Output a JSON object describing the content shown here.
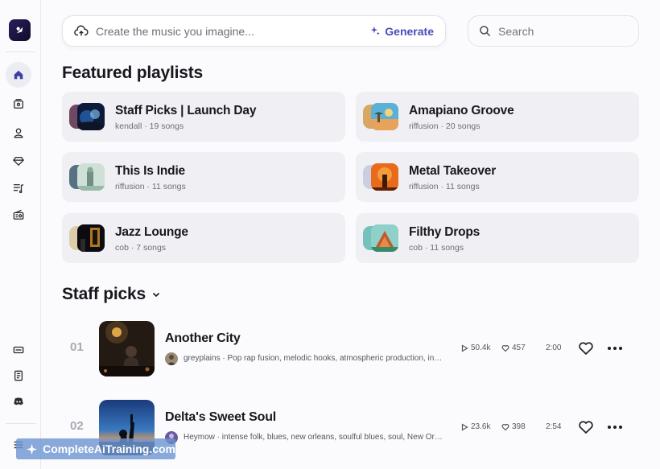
{
  "app": {
    "logo_icon": "riffusion-logo-icon",
    "accent_color": "#4b4bb8"
  },
  "sidebar": {
    "top_items": [
      {
        "icon": "home-icon",
        "active": true
      },
      {
        "icon": "library-icon",
        "active": false
      },
      {
        "icon": "profile-icon",
        "active": false
      },
      {
        "icon": "gem-icon",
        "active": false
      },
      {
        "icon": "playlist-icon",
        "active": false
      },
      {
        "icon": "radio-icon",
        "active": false
      }
    ],
    "bottom_items": [
      {
        "icon": "ticket-icon"
      },
      {
        "icon": "document-icon"
      },
      {
        "icon": "discord-icon"
      },
      {
        "icon": "menu-icon"
      }
    ]
  },
  "prompt_bar": {
    "placeholder": "Create the music you imagine...",
    "generate_label": "Generate"
  },
  "search": {
    "placeholder": "Search"
  },
  "featured": {
    "title": "Featured playlists",
    "playlists": [
      {
        "title": "Staff Picks | Launch Day",
        "meta": "kendall · 19 songs"
      },
      {
        "title": "Amapiano Groove",
        "meta": "riffusion · 20 songs"
      },
      {
        "title": "This Is Indie",
        "meta": "riffusion · 11 songs"
      },
      {
        "title": "Metal Takeover",
        "meta": "riffusion · 11 songs"
      },
      {
        "title": "Jazz Lounge",
        "meta": "cob · 7 songs"
      },
      {
        "title": "Filthy Drops",
        "meta": "cob · 11 songs"
      }
    ]
  },
  "staff_picks": {
    "title": "Staff picks",
    "tracks": [
      {
        "number": "01",
        "title": "Another City",
        "meta": "greyplains · Pop rap fusion, melodic hooks, atmospheric production, introspective lyrics",
        "plays": "50.4k",
        "likes": "457",
        "duration": "2:00"
      },
      {
        "number": "02",
        "title": "Delta's Sweet Soul",
        "meta": "Heymow · intense folk, blues, new orleans, soulful blues, soul, New Orleans blues",
        "plays": "23.6k",
        "likes": "398",
        "duration": "2:54"
      }
    ]
  },
  "watermark": {
    "text": "CompleteAiTraining.com"
  }
}
